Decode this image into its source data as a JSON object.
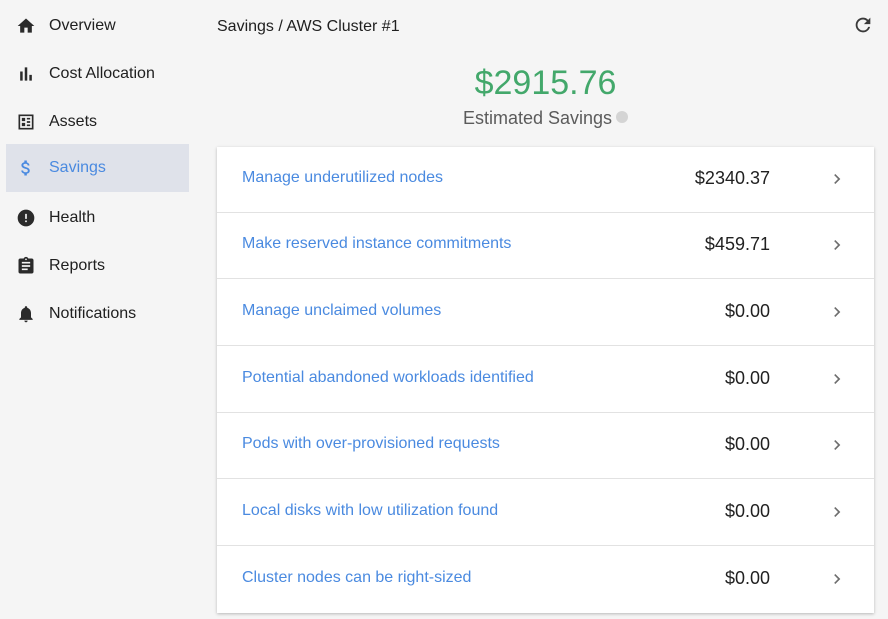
{
  "sidebar": {
    "items": [
      {
        "label": "Overview",
        "icon": "home-icon",
        "active": false
      },
      {
        "label": "Cost Allocation",
        "icon": "bar-chart-icon",
        "active": false
      },
      {
        "label": "Assets",
        "icon": "assets-icon",
        "active": false
      },
      {
        "label": "Savings",
        "icon": "dollar-icon",
        "active": true
      },
      {
        "label": "Health",
        "icon": "alert-icon",
        "active": false
      },
      {
        "label": "Reports",
        "icon": "clipboard-icon",
        "active": false
      },
      {
        "label": "Notifications",
        "icon": "bell-icon",
        "active": false
      }
    ]
  },
  "header": {
    "breadcrumb": "Savings / AWS Cluster #1",
    "refresh_icon": "refresh-icon"
  },
  "summary": {
    "total": "$2915.76",
    "label": "Estimated Savings"
  },
  "savings": [
    {
      "label": "Manage underutilized nodes",
      "value": "$2340.37"
    },
    {
      "label": "Make reserved instance commitments",
      "value": "$459.71"
    },
    {
      "label": "Manage unclaimed volumes",
      "value": "$0.00"
    },
    {
      "label": "Potential abandoned workloads identified",
      "value": "$0.00"
    },
    {
      "label": "Pods with over-provisioned requests",
      "value": "$0.00"
    },
    {
      "label": "Local disks with low utilization found",
      "value": "$0.00"
    },
    {
      "label": "Cluster nodes can be right-sized",
      "value": "$0.00"
    }
  ],
  "colors": {
    "accent": "#4a8ae0",
    "savings_green": "#43a86b",
    "active_bg": "#dfe2ea"
  }
}
